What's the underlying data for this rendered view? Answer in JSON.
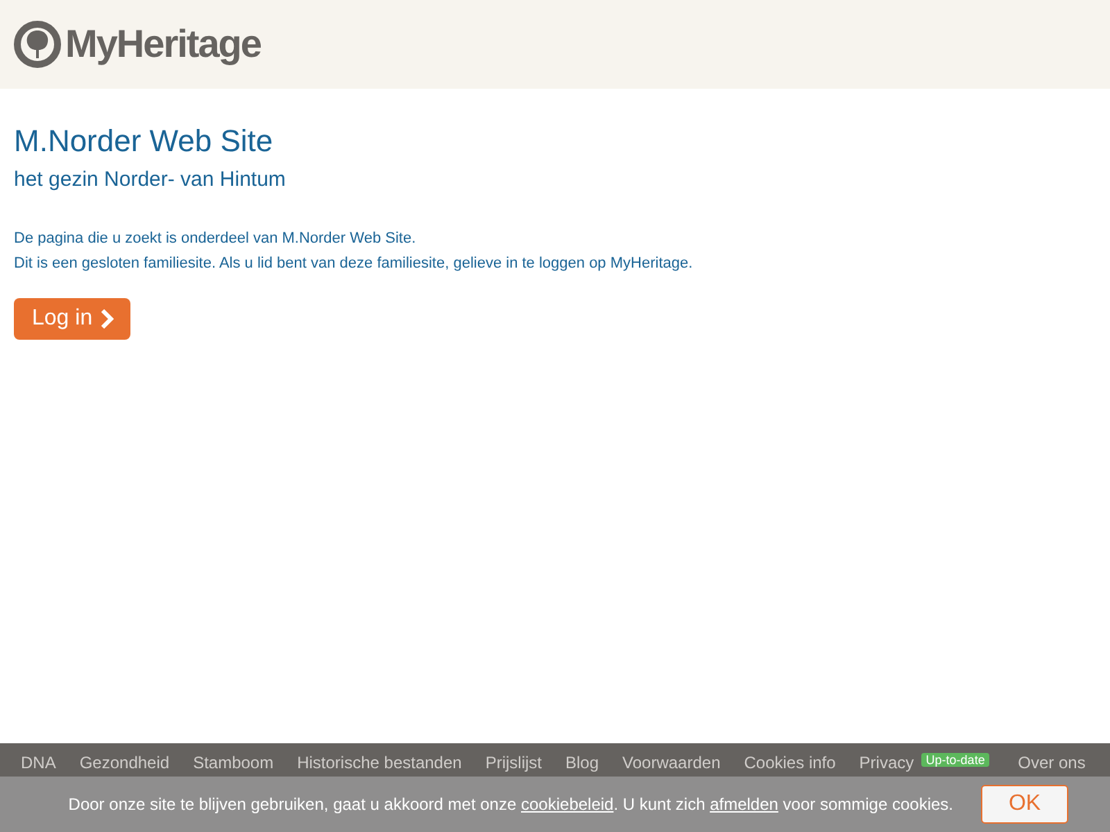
{
  "header": {
    "logo_text": "MyHeritage"
  },
  "site": {
    "title": "M.Norder Web Site",
    "subtitle": "het gezin Norder- van Hintum"
  },
  "message": [
    "De pagina die u zoekt is onderdeel van M.Norder Web Site.",
    "Dit is een gesloten familiesite. Als u lid bent van deze familiesite, gelieve in te loggen op MyHeritage."
  ],
  "login_button": {
    "label": "Log in"
  },
  "footer_links": [
    {
      "label": "DNA"
    },
    {
      "label": "Gezondheid"
    },
    {
      "label": "Stamboom"
    },
    {
      "label": "Historische bestanden"
    },
    {
      "label": "Prijslijst"
    },
    {
      "label": "Blog"
    },
    {
      "label": "Voorwaarden"
    },
    {
      "label": "Cookies info"
    },
    {
      "label": "Privacy",
      "badge": "Up-to-date"
    },
    {
      "label": "Over ons"
    }
  ],
  "cookie_notice": {
    "before": "Door onze site te blijven gebruiken, gaat u akkoord met onze ",
    "link_1": "cookiebeleid",
    "middle": ". U kunt zich ",
    "link_2": "afmelden",
    "after": " voor sommige cookies.",
    "button": "OK"
  }
}
